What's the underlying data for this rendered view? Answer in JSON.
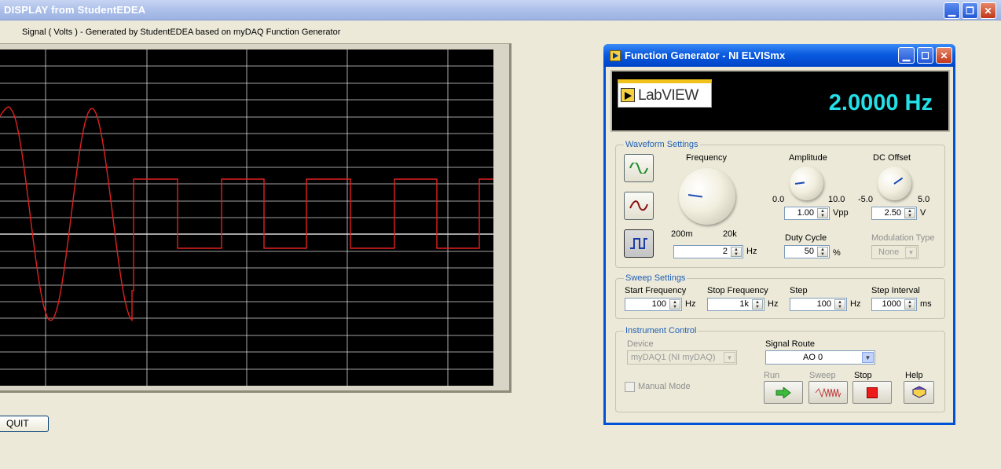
{
  "main_window": {
    "title": "DISPLAY from StudentEDEA",
    "caption": "Signal ( Volts ) - Generated by StudentEDEA based on myDAQ Function Generator",
    "quit_label": "QUIT"
  },
  "generator": {
    "title": "Function Generator - NI ELVISmx",
    "logo_text": "LabVIEW",
    "readout": "2.0000 Hz",
    "waveform": {
      "group_label": "Waveform Settings",
      "waveforms": [
        "sine",
        "triangle",
        "square"
      ],
      "selected": "square",
      "frequency": {
        "label": "Frequency",
        "min_label": "200m",
        "max_label": "20k",
        "value": "2",
        "unit": "Hz"
      },
      "amplitude": {
        "label": "Amplitude",
        "min_label": "0.0",
        "max_label": "10.0",
        "value": "1.00",
        "unit": "Vpp"
      },
      "dc_offset": {
        "label": "DC Offset",
        "min_label": "-5.0",
        "max_label": "5.0",
        "value": "2.50",
        "unit": "V"
      },
      "duty_cycle": {
        "label": "Duty Cycle",
        "value": "50",
        "unit": "%"
      },
      "modulation": {
        "label": "Modulation Type",
        "value": "None"
      }
    },
    "sweep": {
      "group_label": "Sweep Settings",
      "start_frequency": {
        "label": "Start Frequency",
        "value": "100",
        "unit": "Hz"
      },
      "stop_frequency": {
        "label": "Stop Frequency",
        "value": "1k",
        "unit": "Hz"
      },
      "step": {
        "label": "Step",
        "value": "100",
        "unit": "Hz"
      },
      "step_interval": {
        "label": "Step Interval",
        "value": "1000",
        "unit": "ms"
      }
    },
    "instrument": {
      "group_label": "Instrument Control",
      "device_label": "Device",
      "device_value": "myDAQ1 (NI myDAQ)",
      "signal_route_label": "Signal Route",
      "signal_route_value": "AO 0",
      "manual_mode_label": "Manual Mode",
      "run_label": "Run",
      "sweep_label": "Sweep",
      "stop_label": "Stop",
      "help_label": "Help"
    }
  },
  "colors": {
    "trace": "#e02020",
    "grid": "#d8d8d8",
    "readout": "#22e0e8",
    "group_label": "#1f5fb5"
  }
}
